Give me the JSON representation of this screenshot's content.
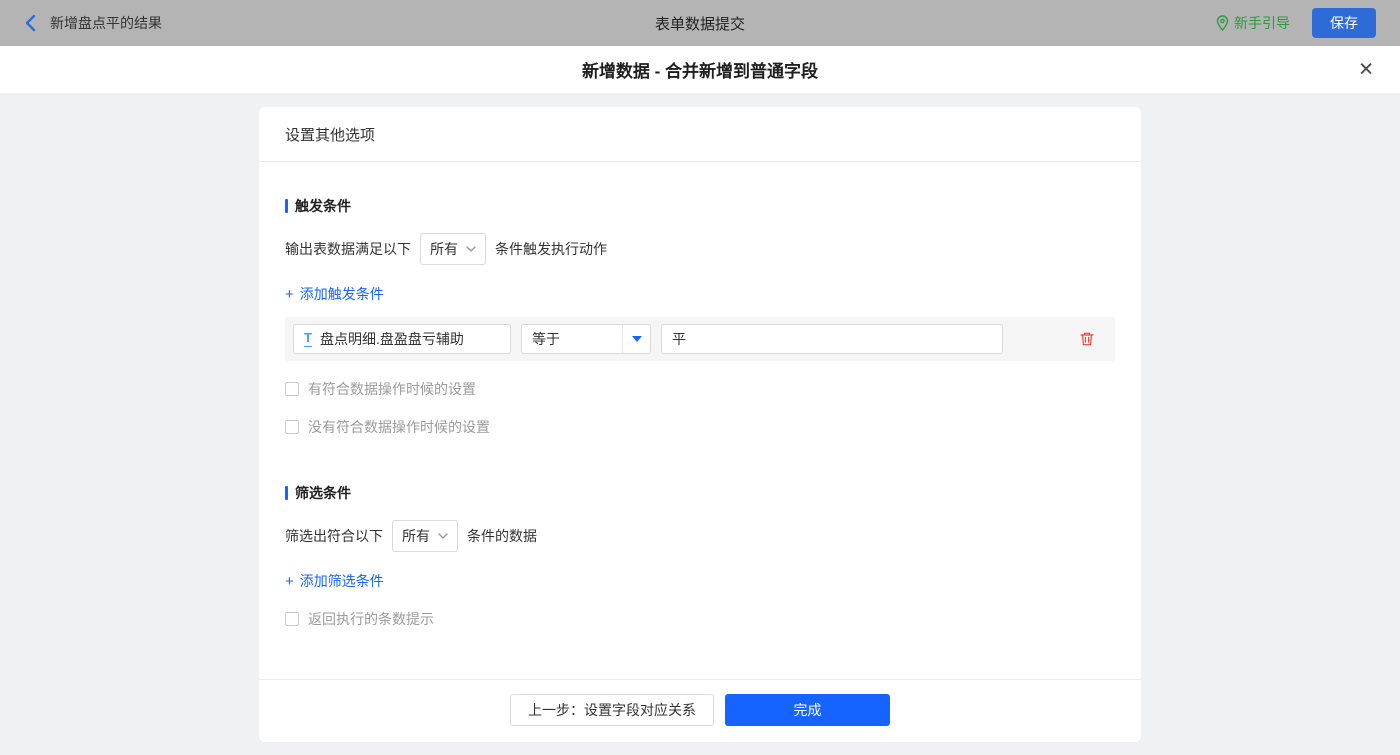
{
  "topbar": {
    "back_label": "新增盘点平的结果",
    "title": "表单数据提交",
    "guide_label": "新手引导",
    "save_label": "保存"
  },
  "dialog": {
    "title": "新增数据 - 合并新增到普通字段"
  },
  "card": {
    "header": "设置其他选项",
    "trigger": {
      "title": "触发条件",
      "prefix": "输出表数据满足以下",
      "select_value": "所有",
      "suffix": "条件触发执行动作",
      "add_link": "添加触发条件",
      "condition": {
        "field": "盘点明细.盘盈盘亏辅助",
        "operator": "等于",
        "value": "平"
      },
      "checkbox_has_match": "有符合数据操作时候的设置",
      "checkbox_no_match": "没有符合数据操作时候的设置"
    },
    "filter": {
      "title": "筛选条件",
      "prefix": "筛选出符合以下",
      "select_value": "所有",
      "suffix": "条件的数据",
      "add_link": "添加筛选条件",
      "checkbox_count_tip": "返回执行的条数提示"
    },
    "footer": {
      "prev_label": "上一步：设置字段对应关系",
      "done_label": "完成"
    }
  },
  "icons": {
    "plus": "+",
    "close": "✕",
    "field_type": "T"
  },
  "colors": {
    "accent": "#1664ff",
    "green": "#2f9a3e",
    "danger": "#f2413d",
    "topbar_bg": "#b4b4b4"
  }
}
